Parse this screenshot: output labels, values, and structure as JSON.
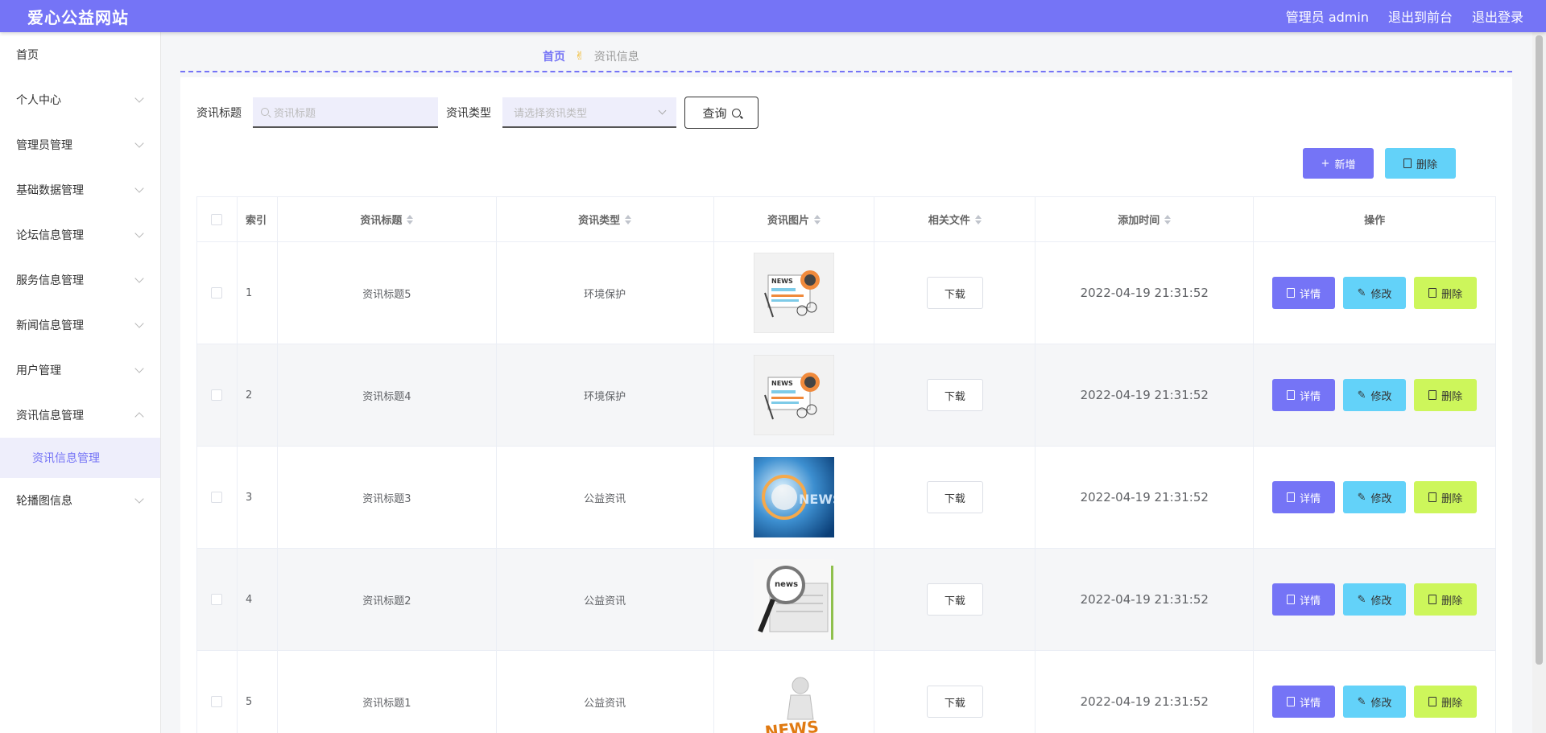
{
  "header": {
    "brand": "爱心公益网站",
    "admin_label": "管理员 admin",
    "exit_front": "退出到前台",
    "logout": "退出登录"
  },
  "sidebar": {
    "items": [
      {
        "label": "首页",
        "has_chevron": false
      },
      {
        "label": "个人中心",
        "has_chevron": true
      },
      {
        "label": "管理员管理",
        "has_chevron": true
      },
      {
        "label": "基础数据管理",
        "has_chevron": true
      },
      {
        "label": "论坛信息管理",
        "has_chevron": true
      },
      {
        "label": "服务信息管理",
        "has_chevron": true
      },
      {
        "label": "新闻信息管理",
        "has_chevron": true
      },
      {
        "label": "用户管理",
        "has_chevron": true
      },
      {
        "label": "资讯信息管理",
        "has_chevron": true,
        "expanded": true
      },
      {
        "label": "轮播图信息",
        "has_chevron": true
      }
    ],
    "active_sub": "资讯信息管理"
  },
  "breadcrumb": {
    "home": "首页",
    "separator": "✌",
    "current": "资讯信息"
  },
  "search": {
    "title_label": "资讯标题",
    "title_placeholder": "资讯标题",
    "type_label": "资讯类型",
    "type_placeholder": "请选择资讯类型",
    "query_button": "查询"
  },
  "actions": {
    "add": "新增",
    "delete": "删除"
  },
  "table": {
    "headers": [
      "索引",
      "资讯标题",
      "资讯类型",
      "资讯图片",
      "相关文件",
      "添加时间",
      "操作"
    ],
    "download_label": "下载",
    "op_detail": "详情",
    "op_edit": "修改",
    "op_delete": "删除",
    "rows": [
      {
        "index": "1",
        "title": "资讯标题5",
        "type": "环境保护",
        "image": "news-paper",
        "time": "2022-04-19 21:31:52"
      },
      {
        "index": "2",
        "title": "资讯标题4",
        "type": "环境保护",
        "image": "news-paper",
        "time": "2022-04-19 21:31:52"
      },
      {
        "index": "3",
        "title": "资讯标题3",
        "type": "公益资讯",
        "image": "news-globe",
        "time": "2022-04-19 21:31:52"
      },
      {
        "index": "4",
        "title": "资讯标题2",
        "type": "公益资讯",
        "image": "news-magnifier",
        "time": "2022-04-19 21:31:52"
      },
      {
        "index": "5",
        "title": "资讯标题1",
        "type": "公益资讯",
        "image": "news-3d",
        "time": "2022-04-19 21:31:52"
      }
    ]
  },
  "colors": {
    "primary": "#7574f6",
    "info": "#63d2f9",
    "lime": "#cdf65b"
  }
}
